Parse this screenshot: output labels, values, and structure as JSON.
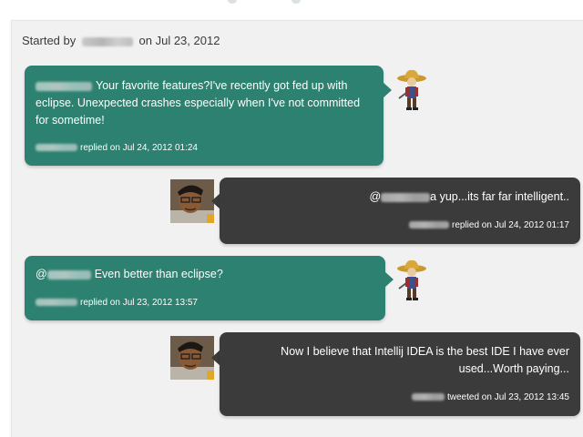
{
  "thread": {
    "started_prefix": "Started by",
    "started_suffix": "on Jul 23, 2012"
  },
  "messages": [
    {
      "side": "left",
      "style": "teal",
      "text": "Your favorite features?I've recently got fed up with eclipse. Unexpected crashes especially when I've not committed for sometime!",
      "meta": "replied on Jul 24, 2012 01:24",
      "avatar": "cowboy-avatar"
    },
    {
      "side": "right",
      "style": "dark",
      "text_prefix": "@",
      "text": "a yup...its far far intelligent..",
      "meta": "replied on Jul 24, 2012 01:17",
      "avatar": "person-avatar"
    },
    {
      "side": "left",
      "style": "teal",
      "text_prefix": "@",
      "text": "Even better than eclipse?",
      "meta": "replied on Jul 23, 2012 13:57",
      "avatar": "cowboy-avatar"
    },
    {
      "side": "right",
      "style": "dark",
      "text": "Now I believe that Intellij IDEA is the best IDE I have ever used...Worth paying...",
      "meta": "tweeted on Jul 23, 2012 13:45",
      "avatar": "person-avatar"
    }
  ],
  "colors": {
    "teal_bubble": "#2d8170",
    "dark_bubble": "#3a3b3a",
    "background": "#f1f1f1"
  }
}
